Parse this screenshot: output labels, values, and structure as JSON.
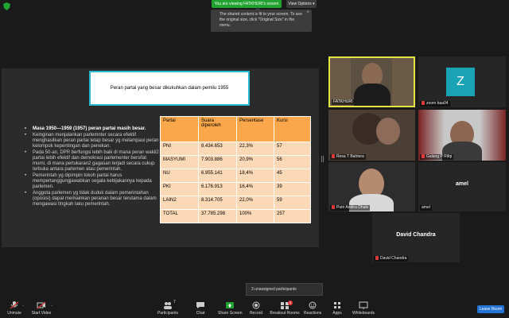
{
  "topbar": {
    "banner": "You are viewing FATKHURI's screen",
    "view_options": "View Options ▾",
    "tooltip": "The shared content is fit to your screen. To see the original size, click \"Original Size\" in the menu."
  },
  "slide": {
    "title": "Peran partai yang besar dikukuhkan dalam pemilu 1955",
    "bullets": [
      "Masa 1950—1959 (1957) peran partai masih besar.",
      "Keinginan menjalankan parlemnter secara efektif menghasilkan peran partai tetap besar yg melampaui peran kelompok kepentingan dan penekan.",
      "Pada 50-an, DPR berfungsi lebih baik di mana peran wakil2 partai lebih efektif dan demokrasi parlementer bersifat murni, di mana pertukaran2 gagasan terjadi secara cukup terbuka antara parlemen  atau pemerintah.",
      "Pemerintah yg dipimpin tokoh partai harus mempertanggungjawabkan segala kebijakannya kepada parlemen.",
      "Anggota parlemen yg tidak duduk dalam pemerintahan (oposisi) dapat memainkan peranan besar terutama dalam mengawasi tingkah laku pemerintah."
    ],
    "table": {
      "headers": [
        "Partai",
        "Suara diperoleh",
        "Persentase",
        "Kursi"
      ],
      "rows": [
        [
          "PNI",
          "8.434.653",
          "22,3%",
          "57"
        ],
        [
          "MASYUMI",
          "7.903.886",
          "20,9%",
          "56"
        ],
        [
          "NU",
          "6.955.141",
          "18,4%",
          "45"
        ],
        [
          "PKI",
          "6.176.913",
          "16,4%",
          "39"
        ],
        [
          "LAIN2",
          "8.314.705",
          "22,0%",
          "59"
        ],
        [
          "TOTAL",
          "37.785.298",
          "100%",
          "257"
        ]
      ]
    }
  },
  "participants_grid": [
    {
      "name": "FATKHURI",
      "muted": false
    },
    {
      "name": "zoom baa04",
      "initial": "Z",
      "muted": true
    },
    {
      "name": "Resa T Bahtera",
      "muted": true
    },
    {
      "name": "Galang P Rifqi",
      "muted": true
    },
    {
      "name": "Putri Andira Dhabi",
      "muted": true
    },
    {
      "name": "amel",
      "muted": false
    },
    {
      "name": "David Chandra",
      "muted": true
    }
  ],
  "unassigned": "3 unassigned participants",
  "toolbar": {
    "unmute": "Unmute",
    "start_video": "Start Video",
    "participants": "Participants",
    "participants_count": "7",
    "chat": "Chat",
    "share_screen": "Share Screen",
    "record": "Record",
    "breakout": "Breakout Rooms",
    "breakout_badge": "3",
    "reactions": "Reactions",
    "apps": "Apps",
    "whiteboards": "Whiteboards",
    "leave": "Leave Room"
  },
  "colors": {
    "accent_green": "#21a331",
    "table_header": "#f9a74a",
    "table_cell": "#fcd9b6",
    "active_speaker": "#e4e444",
    "leave_button": "#2374d6",
    "zoom_avatar": "#1aa3b4"
  }
}
